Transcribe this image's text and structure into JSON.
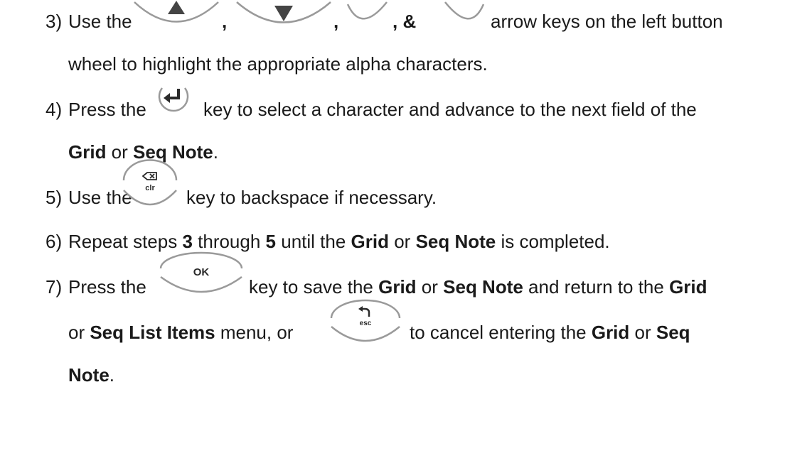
{
  "steps": [
    {
      "number": "3)",
      "parts": [
        "Use the",
        ",",
        ",",
        ", &",
        "arrow keys on the left button"
      ],
      "continuation": "wheel to highlight the appropriate alpha characters.",
      "icons": [
        "arrow-up-key-icon",
        "arrow-down-key-icon",
        "arrow-left-key-icon",
        "arrow-right-key-icon"
      ]
    },
    {
      "number": "4)",
      "before_icon": "Press the",
      "after_icon": "key to select a character and advance to the next field of the",
      "line2": {
        "b1": "Grid",
        "t1": " or ",
        "b2": "Seq Note",
        "t2": "."
      },
      "icons": [
        "enter-key-icon"
      ]
    },
    {
      "number": "5)",
      "before_icon": "Use the",
      "icon_label": "clr",
      "after_icon": "key to backspace if necessary.",
      "icons": [
        "clear-backspace-key-icon"
      ]
    },
    {
      "number": "6)",
      "segments": [
        {
          "t": "Repeat steps "
        },
        {
          "b": "3"
        },
        {
          "t": " through "
        },
        {
          "b": "5"
        },
        {
          "t": " until the "
        },
        {
          "b": "Grid"
        },
        {
          "t": " or "
        },
        {
          "b": "Seq Note"
        },
        {
          "t": " is completed."
        }
      ]
    },
    {
      "number": "7)",
      "before_icon": "Press the",
      "ok_label": "OK",
      "esc_label": "esc",
      "line1": [
        {
          "t": "key to save the "
        },
        {
          "b": "Grid"
        },
        {
          "t": " or "
        },
        {
          "b": "Seq Note"
        },
        {
          "t": " and return to the "
        },
        {
          "b": "Grid"
        }
      ],
      "line2_a": [
        {
          "t": "or "
        },
        {
          "b": "Seq List Items"
        },
        {
          "t": " menu, or"
        }
      ],
      "line2_b": [
        {
          "t": "to cancel entering the "
        },
        {
          "b": "Grid"
        },
        {
          "t": " or "
        },
        {
          "b": "Seq"
        }
      ],
      "line3": [
        {
          "b": "Note"
        },
        {
          "t": "."
        }
      ],
      "icons": [
        "ok-key-icon",
        "esc-key-icon"
      ]
    }
  ]
}
